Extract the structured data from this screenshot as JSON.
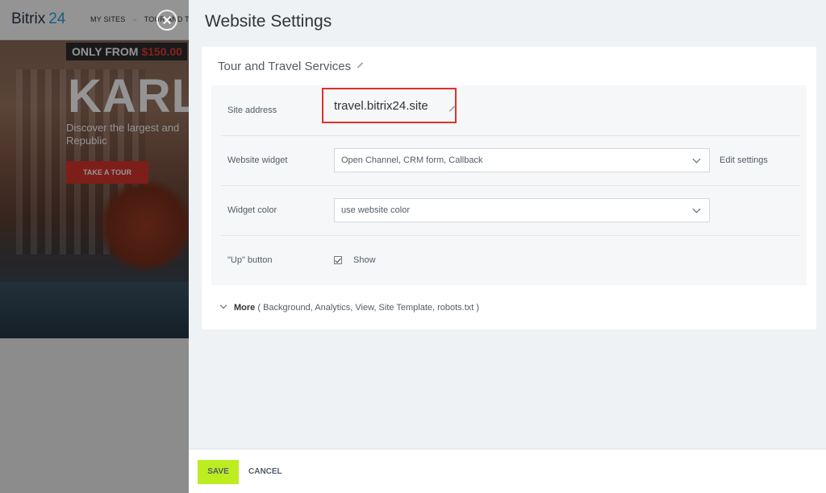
{
  "background": {
    "logo_text": "Bitrix",
    "logo_num": "24",
    "nav_my_sites": "MY SITES",
    "nav_sep": "–",
    "nav_tour": "TOUR AND TI",
    "price_prefix": "ONLY FROM",
    "price_amount": "$150.00",
    "hero_title": "KARL",
    "hero_subtitle": "Discover the largest and Republic",
    "tour_button": "TAKE A TOUR"
  },
  "panel": {
    "title": "Website Settings",
    "site_name": "Tour and Travel Services",
    "rows": {
      "address": {
        "label": "Site address",
        "value": "travel.bitrix24.site"
      },
      "widget": {
        "label": "Website widget",
        "value": "Open Channel, CRM form, Callback",
        "link": "Edit settings"
      },
      "color": {
        "label": "Widget color",
        "value": "use website color"
      },
      "up": {
        "label": "\"Up\" button",
        "checkbox_label": "Show",
        "checked": true
      }
    },
    "more": {
      "label": "More",
      "items": "( Background,  Analytics,  View,  Site Template,  robots.txt )"
    }
  },
  "footer": {
    "save": "SAVE",
    "cancel": "CANCEL"
  },
  "colors": {
    "accent_save": "#bbed21",
    "highlight_border": "#e0312c",
    "logo_accent": "#2fa6db"
  }
}
